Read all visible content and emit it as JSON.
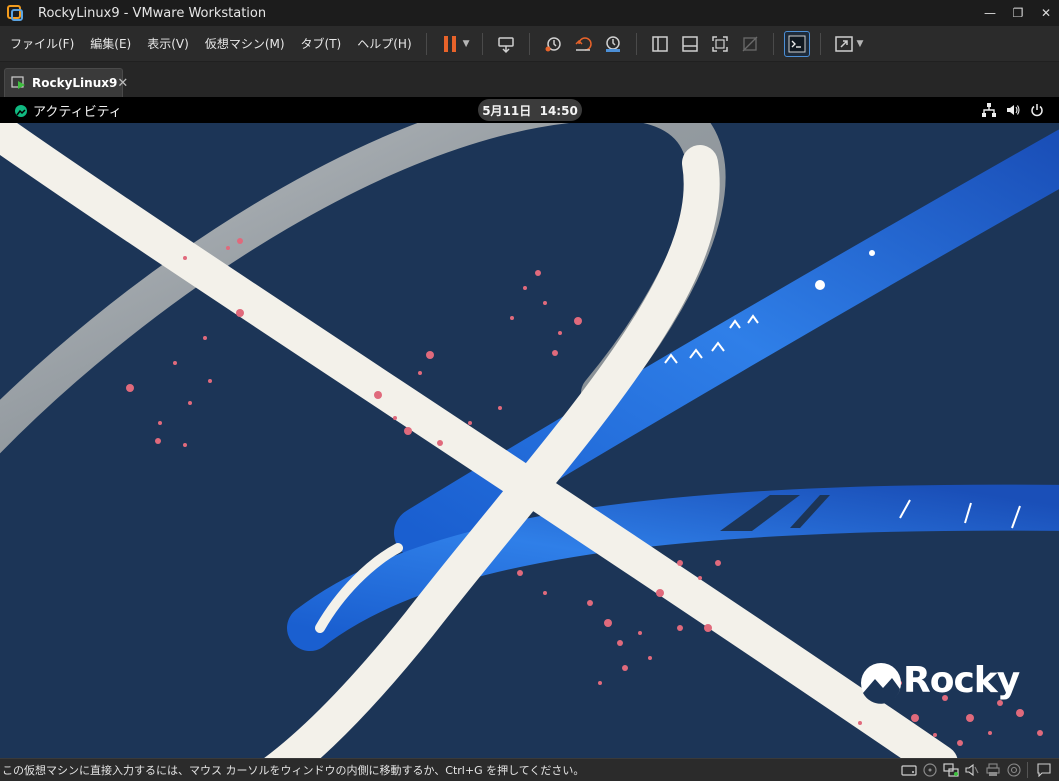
{
  "window": {
    "title": "RockyLinux9 - VMware Workstation",
    "app_icon": "vmware-icon",
    "controls": {
      "minimize": "—",
      "restore": "❐",
      "close": "✕"
    }
  },
  "menu": {
    "items": [
      "ファイル(F)",
      "編集(E)",
      "表示(V)",
      "仮想マシン(M)",
      "タブ(T)",
      "ヘルプ(H)"
    ]
  },
  "toolbar": {
    "accent_color": "#e8632a",
    "buttons": [
      "pause-icon",
      "send-ctrl-alt-del-icon",
      "snapshot-icon",
      "revert-snapshot-icon",
      "snapshot-manager-icon",
      "library-view-icon",
      "thumbnail-view-icon",
      "full-screen-icon",
      "unity-icon",
      "console-view-icon",
      "stretch-guest-icon"
    ]
  },
  "tabs": {
    "vm_tab_label": "RockyLinux9",
    "close_glyph": "✕"
  },
  "guest": {
    "activities_label": "アクティビティ",
    "clock": "5月11日  14:50",
    "tray": [
      "network-icon",
      "volume-icon",
      "power-icon"
    ],
    "wallpaper_logo": "Rocky",
    "background_color": "#1c3557"
  },
  "statusbar": {
    "text": "この仮想マシンに直接入力するには、マウス カーソルをウィンドウの内側に移動するか、Ctrl+G を押してください。",
    "icons": [
      "hard-disk-icon",
      "cd-dvd-icon",
      "network-adapter-icon",
      "sound-card-icon",
      "printer-icon",
      "display-icon",
      "message-icon"
    ]
  }
}
